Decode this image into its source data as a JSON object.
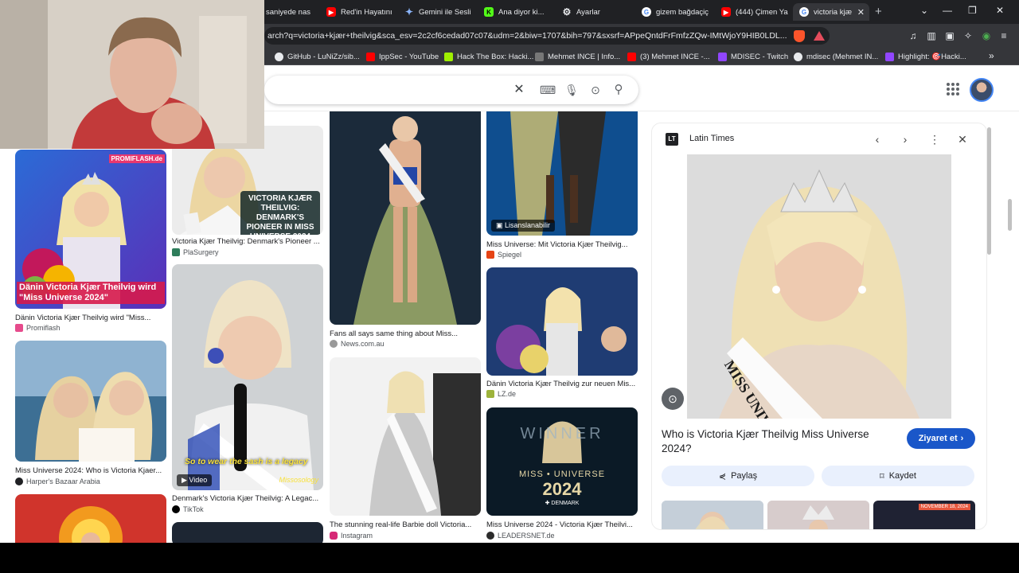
{
  "browser": {
    "tabs": [
      {
        "label": "saniyede nas",
        "icon": "page-icon",
        "color": "#8ab4f8"
      },
      {
        "label": "Red'in Hayatını",
        "icon": "youtube-icon",
        "color": "#ff0000"
      },
      {
        "label": "Gemini ile Sesli",
        "icon": "gemini-icon",
        "color": "#8ab4f8"
      },
      {
        "label": "Ana diyor ki...",
        "icon": "kick-icon",
        "color": "#53fc18"
      },
      {
        "label": "Ayarlar",
        "icon": "gear-icon",
        "color": "#e8eaed"
      },
      {
        "label": "gizem bağdaçiç",
        "icon": "google-icon",
        "color": "#ffffff"
      },
      {
        "label": "(444) Çimen Ya",
        "icon": "youtube-icon",
        "color": "#ff0000"
      },
      {
        "label": "victoria kjæ",
        "icon": "google-icon",
        "color": "#ffffff",
        "active": true
      }
    ],
    "new_tab": "+",
    "url": "arch?q=victoria+kjær+theilvig&sca_esv=2c2cf6cedad07c07&udm=2&biw=1707&bih=797&sxsrf=APpeQntdFrFmfzZQw-IMtWjoY9HIB0LDL...",
    "bookmarks": [
      {
        "label": "GitHub - LuNiZz/sib...",
        "color": "#e8eaed"
      },
      {
        "label": "IppSec - YouTube",
        "color": "#ff0000"
      },
      {
        "label": "Hack The Box: Hacki...",
        "color": "#9fef00"
      },
      {
        "label": "Mehmet INCE | Info...",
        "color": "#777777"
      },
      {
        "label": "(3) Mehmet INCE -...",
        "color": "#ff0000"
      },
      {
        "label": "MDISEC - Twitch",
        "color": "#9146ff"
      },
      {
        "label": "mdisec (Mehmet IN...",
        "color": "#e8eaed"
      },
      {
        "label": "Highlight: 🎯Hacki...",
        "color": "#9146ff"
      }
    ]
  },
  "results": {
    "col1": [
      {
        "caption": "Dänin Victoria Kjær Theilvig wird \"Miss...",
        "source": "Promiflash",
        "source_color": "#e64b8c",
        "overlay": "Dänin Victoria Kjær Theilvig wird \"Miss Universe 2024\"",
        "brand": "PROMIFLASH.de"
      },
      {
        "caption": "Miss Universe 2024: Who is Victoria Kjaer...",
        "source": "Harper's Bazaar Arabia",
        "source_color": "#202124"
      }
    ],
    "col2": [
      {
        "caption": "Victoria Kjær Theilvig: Denmark's Pioneer ...",
        "source": "PlaSurgery",
        "source_color": "#2e7d5b",
        "overlay": "VICTORIA KJÆR THEILVIG: DENMARK'S PIONEER IN MISS UNIVERSE 2024"
      },
      {
        "caption": "Denmark's Victoria Kjær Theilvig: A Legac...",
        "source": "TikTok",
        "source_color": "#000000",
        "overlay": "So to wear the sash is a legacy",
        "badge": "Video",
        "watermark": "Missosology"
      }
    ],
    "col3": [
      {
        "caption": "Fans all says same thing about Miss...",
        "source": "News.com.au",
        "source_color": "#999999"
      },
      {
        "caption": "The stunning real-life Barbie doll Victoria...",
        "source": "Instagram",
        "source_color": "#d62976"
      }
    ],
    "col4": [
      {
        "caption": "Miss Universe: Mit Victoria Kjær Theilvig...",
        "source": "Spiegel",
        "source_color": "#e64415",
        "badge": "Lisanslanabilir"
      },
      {
        "caption": "Dänin Victoria Kjær Theilvig zur neuen Mis...",
        "source": "LZ.de",
        "source_color": "#9db33b"
      },
      {
        "caption": "Miss Universe 2024 - Victoria Kjær Theilvi...",
        "source": "LEADERSNET.de",
        "source_color": "#2b2b2b",
        "overlay_top": "WINNER",
        "overlay_mid": "MISS • UNIVERSE",
        "overlay_year": "2024",
        "overlay_flag": "DENMARK"
      }
    ]
  },
  "panel": {
    "source_logo": "LT",
    "source": "Latin Times",
    "title": "Who is Victoria Kjær Theilvig Miss Universe 2024?",
    "visit_label": "Ziyaret et",
    "share_label": "Paylaş",
    "save_label": "Kaydet",
    "sash_text": "MISS UNIVERSE",
    "related_date": "NOVEMBER 18, 2024"
  }
}
